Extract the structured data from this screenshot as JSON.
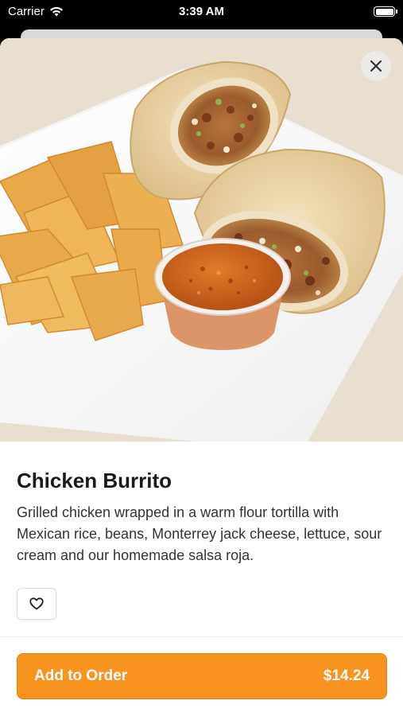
{
  "status_bar": {
    "carrier": "Carrier",
    "time": "3:39 AM",
    "wifi_icon": "wifi-icon",
    "battery_icon": "battery-full-icon"
  },
  "sheet": {
    "close_icon": "close-icon"
  },
  "item": {
    "title": "Chicken Burrito",
    "description": "Grilled chicken wrapped in a warm flour tortilla with Mexican rice, beans, Monterrey jack cheese, lettuce, sour cream and our homemade salsa roja.",
    "favorite_icon": "heart-outline-icon"
  },
  "order": {
    "label": "Add to Order",
    "price": "$14.24",
    "accent_color": "#f7931e"
  }
}
